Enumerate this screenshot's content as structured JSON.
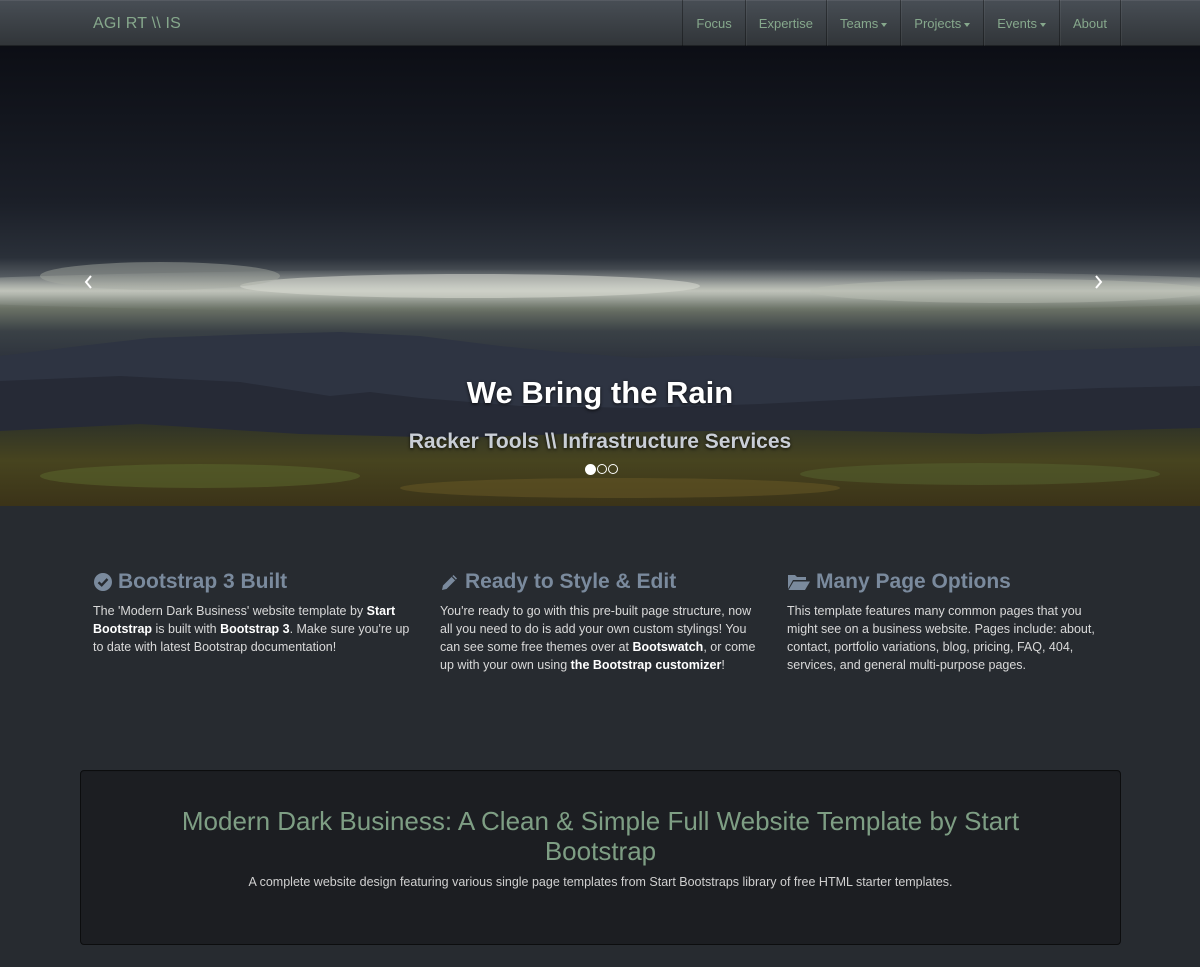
{
  "navbar": {
    "brand": "AGI RT \\\\ IS",
    "items": [
      {
        "label": "Focus",
        "dropdown": false
      },
      {
        "label": "Expertise",
        "dropdown": false
      },
      {
        "label": "Teams",
        "dropdown": true
      },
      {
        "label": "Projects",
        "dropdown": true
      },
      {
        "label": "Events",
        "dropdown": true
      },
      {
        "label": "About",
        "dropdown": false
      }
    ]
  },
  "carousel": {
    "title": "We Bring the Rain",
    "subtitle": "Racker Tools \\\\ Infrastructure Services",
    "prev_icon": "chevron-left-icon",
    "next_icon": "chevron-right-icon",
    "slide_count": 3,
    "active_slide": 1
  },
  "features": [
    {
      "icon": "check-circle-icon",
      "title": "Bootstrap 3 Built",
      "text_parts": [
        "The 'Modern Dark Business' website template by ",
        "Start Bootstrap",
        " is built with ",
        "Bootstrap 3",
        ". Make sure you're up to date with latest Bootstrap documentation!"
      ]
    },
    {
      "icon": "pencil-icon",
      "title": "Ready to Style & Edit",
      "text_parts": [
        "You're ready to go with this pre-built page structure, now all you need to do is add your own custom stylings! You can see some free themes over at ",
        "Bootswatch",
        ", or come up with your own using ",
        "the Bootstrap customizer",
        "!"
      ]
    },
    {
      "icon": "folder-open-icon",
      "title": "Many Page Options",
      "text_parts": [
        "This template features many common pages that you might see on a business website. Pages include: about, contact, portfolio variations, blog, pricing, FAQ, 404, services, and general multi-purpose pages."
      ]
    }
  ],
  "well": {
    "heading": "Modern Dark Business: A Clean & Simple Full Website Template by Start Bootstrap",
    "text": "A complete website design featuring various single page templates from Start Bootstraps library of free HTML starter templates."
  },
  "colors": {
    "background": "#272b30",
    "navbar": "#3a3f44",
    "accent_green": "#86a88c",
    "feature_heading": "#7a8a9d",
    "well_background": "#1c1e22"
  }
}
